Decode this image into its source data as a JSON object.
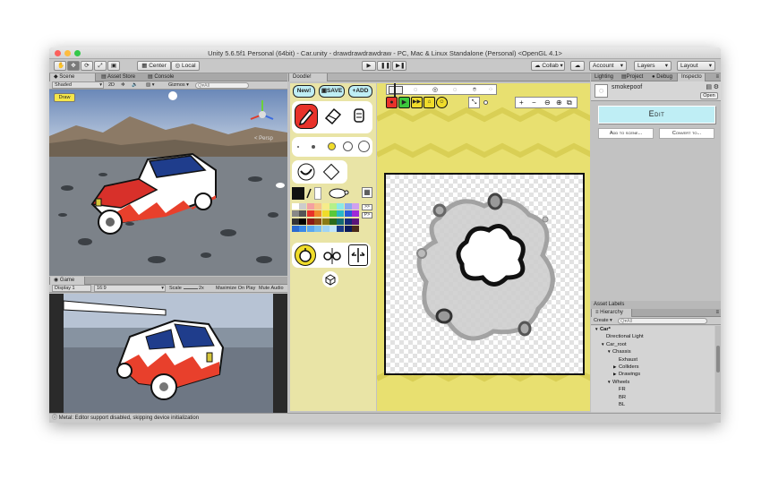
{
  "window": {
    "title": "Unity 5.6.5f1 Personal (64bit) - Car.unity - drawdrawdrawdraw - PC, Mac & Linux Standalone (Personal) <OpenGL 4.1>"
  },
  "toolbar": {
    "pivot_center": "Center",
    "pivot_local": "Local",
    "collab": "Collab ▾",
    "account": "Account",
    "layers": "Layers",
    "layout": "Layout"
  },
  "scene_panel": {
    "tabs": [
      "Scene",
      "Asset Store",
      "Console"
    ],
    "shading": "Shaded",
    "mode_2d": "2D",
    "gizmos": "Gizmos ▾",
    "search_placeholder": "Q▾All",
    "draw_label": "Draw",
    "persp_label": "< Persp"
  },
  "game_panel": {
    "tab": "Game",
    "display": "Display 1",
    "aspect": "16:9",
    "scale_label": "Scale",
    "scale_value": "2x",
    "maximize": "Maximize On Play",
    "mute": "Mute Audio"
  },
  "doodle_panel": {
    "tab": "Doodle!",
    "new_label": "New!",
    "save_label": "SAVE",
    "add_label": "ADD",
    "side_btn_1": ">>",
    "side_btn_2": "P>"
  },
  "inspector": {
    "tabs": [
      "Lighting",
      "Project",
      "Debug",
      "Inspecto"
    ],
    "asset_name": "smokepoof",
    "open_label": "Open",
    "edit_label": "Edit",
    "add_to_scene": "Add to scene...",
    "convert_to": "Convert to...",
    "asset_labels": "Asset Labels"
  },
  "hierarchy": {
    "tab": "Hierarchy",
    "create": "Create ▾",
    "search_placeholder": "Q▾All",
    "items": [
      {
        "label": "Car*",
        "indent": 0,
        "arrow": "▼"
      },
      {
        "label": "Directional Light",
        "indent": 1,
        "arrow": ""
      },
      {
        "label": "Car_root",
        "indent": 1,
        "arrow": "▼"
      },
      {
        "label": "Chassis",
        "indent": 2,
        "arrow": "▼"
      },
      {
        "label": "Exhaust",
        "indent": 3,
        "arrow": ""
      },
      {
        "label": "Colliders",
        "indent": 3,
        "arrow": "▶"
      },
      {
        "label": "Drawings",
        "indent": 3,
        "arrow": "▶"
      },
      {
        "label": "Wheels",
        "indent": 2,
        "arrow": "▼"
      },
      {
        "label": "FR",
        "indent": 3,
        "arrow": ""
      },
      {
        "label": "BR",
        "indent": 3,
        "arrow": ""
      },
      {
        "label": "BL",
        "indent": 3,
        "arrow": ""
      }
    ]
  },
  "status": {
    "message": "Metal: Editor support disabled, skipping device initialization"
  },
  "colors": {
    "doodle_yellow": "#e8e070",
    "tools_bg": "#e9e4a6",
    "edit_button": "#bfeef5",
    "red_tool": "#e8322a"
  }
}
